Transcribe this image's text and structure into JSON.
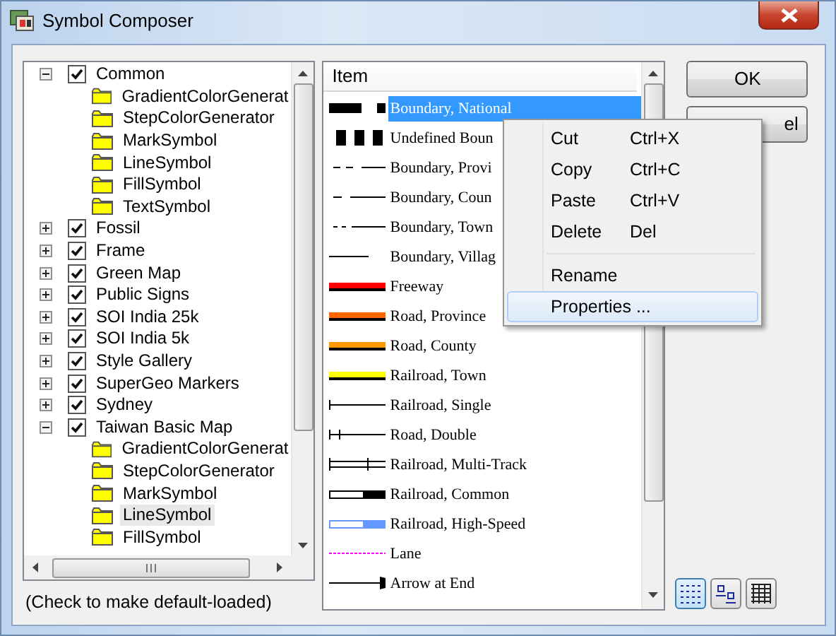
{
  "window": {
    "title": "Symbol Composer"
  },
  "tree": [
    {
      "label": "Common",
      "checked": true,
      "expanded": true,
      "selected": false,
      "children": [
        {
          "label": "GradientColorGenerat",
          "selected": false
        },
        {
          "label": "StepColorGenerator",
          "selected": false
        },
        {
          "label": "MarkSymbol",
          "selected": false
        },
        {
          "label": "LineSymbol",
          "selected": false
        },
        {
          "label": "FillSymbol",
          "selected": false
        },
        {
          "label": "TextSymbol",
          "selected": false
        }
      ]
    },
    {
      "label": "Fossil",
      "checked": true,
      "expanded": false,
      "selected": false
    },
    {
      "label": "Frame",
      "checked": true,
      "expanded": false,
      "selected": false
    },
    {
      "label": "Green Map",
      "checked": true,
      "expanded": false,
      "selected": false
    },
    {
      "label": "Public Signs",
      "checked": true,
      "expanded": false,
      "selected": false
    },
    {
      "label": "SOI India 25k",
      "checked": true,
      "expanded": false,
      "selected": false
    },
    {
      "label": "SOI India 5k",
      "checked": true,
      "expanded": false,
      "selected": false
    },
    {
      "label": "Style Gallery",
      "checked": true,
      "expanded": false,
      "selected": false
    },
    {
      "label": "SuperGeo Markers",
      "checked": true,
      "expanded": false,
      "selected": false
    },
    {
      "label": "Sydney",
      "checked": true,
      "expanded": false,
      "selected": false
    },
    {
      "label": "Taiwan Basic Map",
      "checked": true,
      "expanded": true,
      "selected": false,
      "children": [
        {
          "label": "GradientColorGenerat",
          "selected": false
        },
        {
          "label": "StepColorGenerator",
          "selected": false
        },
        {
          "label": "MarkSymbol",
          "selected": false
        },
        {
          "label": "LineSymbol",
          "selected": true
        },
        {
          "label": "FillSymbol",
          "selected": false
        }
      ]
    }
  ],
  "footer": "(Check to make default-loaded)",
  "symbol_list": {
    "column": "Item",
    "rows": [
      {
        "label": "Boundary, National",
        "kind": "national",
        "selected": true
      },
      {
        "label": "Undefined Boun",
        "kind": "undefined",
        "selected": false
      },
      {
        "label": "Boundary, Provi",
        "kind": "province",
        "selected": false
      },
      {
        "label": "Boundary, Coun",
        "kind": "county",
        "selected": false
      },
      {
        "label": "Boundary, Town",
        "kind": "town",
        "selected": false
      },
      {
        "label": "Boundary, Villag",
        "kind": "village",
        "selected": false
      },
      {
        "label": "Freeway",
        "kind": "road",
        "color": "#ff0000",
        "selected": false
      },
      {
        "label": "Road, Province",
        "kind": "road",
        "color": "#ff6600",
        "selected": false
      },
      {
        "label": "Road, County",
        "kind": "road",
        "color": "#ff9900",
        "selected": false
      },
      {
        "label": "Railroad, Town",
        "kind": "road",
        "color": "#ffff00",
        "selected": false
      },
      {
        "label": "Railroad, Single",
        "kind": "single",
        "selected": false
      },
      {
        "label": "Road, Double",
        "kind": "double",
        "selected": false
      },
      {
        "label": "Railroad, Multi-Track",
        "kind": "multitrack",
        "selected": false
      },
      {
        "label": "Railroad, Common",
        "kind": "rail",
        "color": "#000000",
        "selected": false
      },
      {
        "label": "Railroad, High-Speed",
        "kind": "rail",
        "color": "#6699ff",
        "selected": false
      },
      {
        "label": "Lane",
        "kind": "lane",
        "color": "#ff00ff",
        "selected": false
      },
      {
        "label": "Arrow at End",
        "kind": "arrow",
        "selected": false
      }
    ]
  },
  "buttons": [
    {
      "label": "OK"
    },
    {
      "label": "el"
    }
  ],
  "view_buttons": [
    {
      "kind": "details",
      "selected": true
    },
    {
      "kind": "icons",
      "selected": false
    },
    {
      "kind": "grid",
      "selected": false
    }
  ],
  "context_menu": [
    {
      "kind": "item",
      "label": "Cut",
      "shortcut": "Ctrl+X",
      "selected": false
    },
    {
      "kind": "item",
      "label": "Copy",
      "shortcut": "Ctrl+C",
      "selected": false
    },
    {
      "kind": "item",
      "label": "Paste",
      "shortcut": "Ctrl+V",
      "selected": false
    },
    {
      "kind": "item",
      "label": "Delete",
      "shortcut": "Del",
      "selected": false
    },
    {
      "kind": "separator"
    },
    {
      "kind": "item",
      "label": "Rename",
      "selected": false
    },
    {
      "kind": "item",
      "label": "Properties ...",
      "selected": true
    }
  ]
}
